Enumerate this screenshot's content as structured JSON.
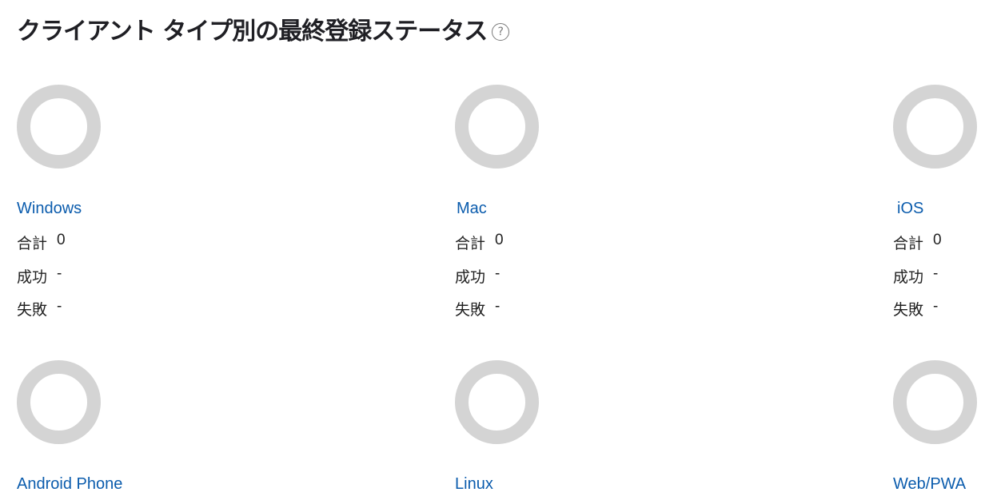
{
  "header": {
    "title": "クライアント タイプ別の最終登録ステータス",
    "help_glyph": "?"
  },
  "labels": {
    "total": "合計",
    "success": "成功",
    "failure": "失敗"
  },
  "colors": {
    "ring": "#d4d4d4",
    "link": "#0b5cad"
  },
  "clients": [
    {
      "name": "Windows",
      "total": "0",
      "success": "-",
      "failure": "-"
    },
    {
      "name": "Mac",
      "total": "0",
      "success": "-",
      "failure": "-"
    },
    {
      "name": "iOS",
      "total": "0",
      "success": "-",
      "failure": "-"
    },
    {
      "name": "Android Phone"
    },
    {
      "name": "Linux"
    },
    {
      "name": "Web/PWA"
    }
  ]
}
